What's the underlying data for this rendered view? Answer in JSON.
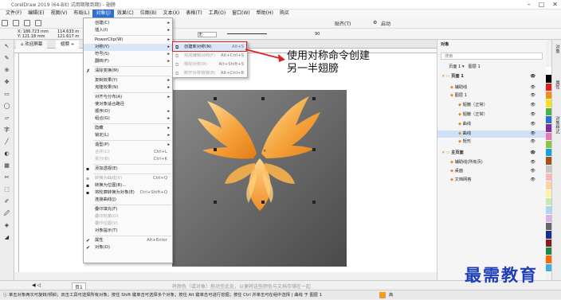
{
  "title": "CorelDraw 2019 (64-Bit) 试用期限到期) - 翅膀",
  "menubar": [
    "文件(F)",
    "编辑(E)",
    "视图(V)",
    "布局(L)",
    "对象(J)",
    "效果(C)",
    "位图(B)",
    "文本(X)",
    "表格(T)",
    "工具(O)",
    "窗口(W)",
    "帮助(H)",
    "购买"
  ],
  "toolbar": {
    "x": "186.723 mm",
    "y": "121.18 mm",
    "w": "114.633 m",
    "h": "121.617 m",
    "pct1": "100.0",
    "pct2": "100.0",
    "none_label": "无",
    "angle": "90",
    "attach": "贴齐(T)",
    "launch": "启动"
  },
  "doctabs": [
    "欢迎屏幕",
    "翅膀"
  ],
  "object_menu": [
    {
      "label": "创建(C)",
      "arrow": true,
      "icon": ""
    },
    {
      "label": "插入(I)",
      "arrow": true,
      "icon": ""
    },
    {
      "sep": true
    },
    {
      "label": "PowerClip(W)",
      "arrow": true,
      "icon": ""
    },
    {
      "label": "对称(Y)",
      "arrow": true,
      "icon": "",
      "hl": true
    },
    {
      "label": "符号(S)",
      "arrow": true,
      "icon": ""
    },
    {
      "label": "翻转(F)",
      "arrow": true,
      "icon": ""
    },
    {
      "sep": true
    },
    {
      "label": "清除变换(M)",
      "arrow": false,
      "icon": "x"
    },
    {
      "sep": true
    },
    {
      "label": "复制效果(Y)",
      "arrow": true,
      "icon": ""
    },
    {
      "label": "克隆效果(N)",
      "arrow": true,
      "icon": ""
    },
    {
      "sep": true
    },
    {
      "label": "对齐与分布(A)",
      "arrow": true,
      "icon": ""
    },
    {
      "label": "使对象适合路径",
      "arrow": false,
      "icon": ""
    },
    {
      "label": "顺序(O)",
      "arrow": true,
      "icon": ""
    },
    {
      "label": "组合(G)",
      "arrow": true,
      "icon": ""
    },
    {
      "sep": true
    },
    {
      "label": "隐藏",
      "arrow": true,
      "icon": ""
    },
    {
      "label": "锁定(L)",
      "arrow": true,
      "icon": ""
    },
    {
      "sep": true
    },
    {
      "label": "造型(P)",
      "arrow": true,
      "icon": ""
    },
    {
      "label": "合并(C)",
      "arrow": false,
      "icon": "",
      "shortcut": "Ctrl+L",
      "dis": true
    },
    {
      "label": "拆分(B)",
      "arrow": false,
      "icon": "",
      "shortcut": "Ctrl+K",
      "dis": true
    },
    {
      "sep": true
    },
    {
      "label": "添加透视(E)",
      "arrow": false,
      "icon": "o"
    },
    {
      "sep": true
    },
    {
      "label": "转换为曲线(V)",
      "arrow": false,
      "icon": "o",
      "shortcut": "Ctrl+Q",
      "dis": true
    },
    {
      "label": "转换为位图(B)...",
      "arrow": false,
      "icon": "o"
    },
    {
      "label": "将轮廓转换为对象(E)",
      "arrow": false,
      "icon": "o",
      "shortcut": "Ctrl+Shift+Q"
    },
    {
      "label": "连接曲线(J)",
      "arrow": false,
      "icon": ""
    },
    {
      "sep": true
    },
    {
      "label": "叠印填充(F)",
      "arrow": false,
      "icon": ""
    },
    {
      "label": "叠印轮廓(O)",
      "arrow": false,
      "icon": "",
      "dis": true
    },
    {
      "label": "叠印位图(V)",
      "arrow": false,
      "icon": "",
      "dis": true
    },
    {
      "label": "对象提示(T)",
      "arrow": false,
      "icon": ""
    },
    {
      "sep": true
    },
    {
      "label": "属性",
      "arrow": false,
      "icon": "",
      "check": true,
      "shortcut": "Alt+Enter"
    },
    {
      "label": "对象(O)",
      "arrow": false,
      "icon": "",
      "check": true
    }
  ],
  "symmetry_submenu": [
    {
      "label": "创建新对称(N)",
      "shortcut": "Alt+S",
      "dis": false
    },
    {
      "label": "完成编辑对称(F)",
      "shortcut": "Alt+Ctrl+S",
      "dis": true
    },
    {
      "label": "移除对称(R)",
      "shortcut": "Alt+Shift+S",
      "dis": true
    },
    {
      "label": "断开对称链接(B)",
      "shortcut": "Alt+Ctrl+B",
      "dis": true
    }
  ],
  "annotation": "使用对称命令创建另一半翅膀",
  "objects_panel": {
    "title": "对象",
    "search_placeholder": "搜索",
    "page_label": "页面 1",
    "layer_label": "图层 1",
    "rows": [
      {
        "label": "页面 1",
        "indent": 0,
        "type": "header"
      },
      {
        "label": "辅助线",
        "indent": 1,
        "type": "item"
      },
      {
        "label": "图层 1",
        "indent": 1,
        "type": "item"
      },
      {
        "label": "翅膀（正常）",
        "indent": 2,
        "type": "item"
      },
      {
        "label": "翅膀（正常）",
        "indent": 2,
        "type": "item"
      },
      {
        "label": "曲线",
        "indent": 2,
        "type": "item"
      },
      {
        "label": "曲线",
        "indent": 2,
        "type": "sel"
      },
      {
        "label": "矩形",
        "indent": 2,
        "type": "item"
      },
      {
        "label": "主页面",
        "indent": 0,
        "type": "header"
      },
      {
        "label": "辅助线(所有页)",
        "indent": 1,
        "type": "item"
      },
      {
        "label": "桌面",
        "indent": 1,
        "type": "item"
      },
      {
        "label": "文档网格",
        "indent": 1,
        "type": "item"
      }
    ]
  },
  "side_tabs": [
    "对象",
    "属性",
    "对象样式"
  ],
  "palette": [
    "#ffffff",
    "#000000",
    "#e21b1b",
    "#f28c1c",
    "#f5e21d",
    "#49b449",
    "#2a6fd1",
    "#7a2f9b",
    "#e878b6",
    "#8cc63f",
    "#14a3d9",
    "#a3521f",
    "#c8c8c8",
    "#f9b7b7",
    "#f9d4a1",
    "#fff3a3",
    "#c9e8b3",
    "#b3d3f2",
    "#d9b3e8",
    "#666666",
    "#1b2c8a",
    "#8a1b1b",
    "#1b8a4b",
    "#ff6600",
    "#3cb0e0"
  ],
  "page_nav": "页1",
  "status_hint": "将颜色（或对象）拖动至此处，以便将这些颜色与文档存储在一起",
  "status_bottom": "单击对象两次可旋转/倾斜；双击工具可选择所有对象；按住 Shift 键单击可选择多个对象；按住 Alt 键单击可进行挖掘；按住 Ctrl 并单击可在组中选择 | 曲线 于 图层 1",
  "fill_label": "高",
  "watermark": "最需教育"
}
